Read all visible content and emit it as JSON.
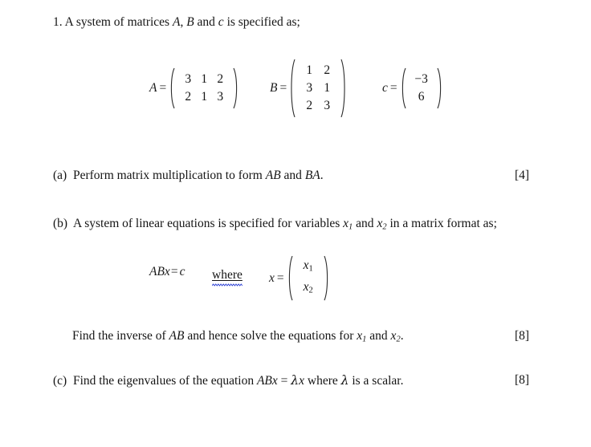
{
  "document": {
    "question_number": "1.",
    "intro": {
      "before_a": "A system of matrices ",
      "var_a": "A",
      "sep1": ", ",
      "var_b": "B",
      "sep2": " and ",
      "var_c": "c",
      "after": " is specified as;"
    },
    "matrices": [
      {
        "name": "A",
        "label": "A",
        "equals": "=",
        "rows": 2,
        "cols": 3,
        "values": [
          "3",
          "1",
          "2",
          "2",
          "1",
          "3"
        ]
      },
      {
        "name": "B",
        "label": "B",
        "equals": "=",
        "rows": 3,
        "cols": 2,
        "values": [
          "1",
          "2",
          "3",
          "1",
          "2",
          "3"
        ]
      },
      {
        "name": "c",
        "label": "c",
        "equals": "=",
        "rows": 2,
        "cols": 1,
        "values": [
          "−3",
          "6"
        ]
      }
    ],
    "parts": [
      {
        "id": "a",
        "marker": "(a)",
        "text_1": "Perform matrix multiplication to form ",
        "math_1": "AB",
        "text_2": " and ",
        "math_2": "BA",
        "text_3": ".",
        "marks": "[4]"
      },
      {
        "id": "b",
        "marker": "(b)",
        "text_1": "A system of linear equations is specified for variables ",
        "var_x1": "x",
        "sub_1": "1",
        "text_2": " and ",
        "var_x2": "x",
        "sub_2": "2",
        "text_3": " in a matrix format as;",
        "equation": {
          "lhs": "ABx",
          "equals": "=",
          "rhs": "c",
          "where": "where",
          "x_label": "x",
          "x_equals": "=",
          "vector": [
            "x₁",
            "x₂"
          ],
          "vector_base": "x",
          "vector_subs": [
            "1",
            "2"
          ]
        },
        "followup": {
          "text_1": "Find the inverse of ",
          "math_1": "AB",
          "text_2": " and hence solve the equations for ",
          "var_x1": "x",
          "sub_1": "1",
          "text_3": " and ",
          "var_x2": "x",
          "sub_2": "2",
          "text_4": ".",
          "marks": "[8]"
        }
      },
      {
        "id": "c",
        "marker": "(c)",
        "text_1": "Find the eigenvalues of the equation  ",
        "math_1": "ABx",
        "eq": " = ",
        "lambda": "λ",
        "math_2": "x",
        "text_2": "  where ",
        "lambda_2": "λ",
        "text_3": " is a scalar.",
        "marks": "[8]"
      }
    ],
    "colors": {
      "text": "#141414",
      "background": "#ffffff",
      "spellcheck_underline": "#2b3fd4"
    }
  }
}
